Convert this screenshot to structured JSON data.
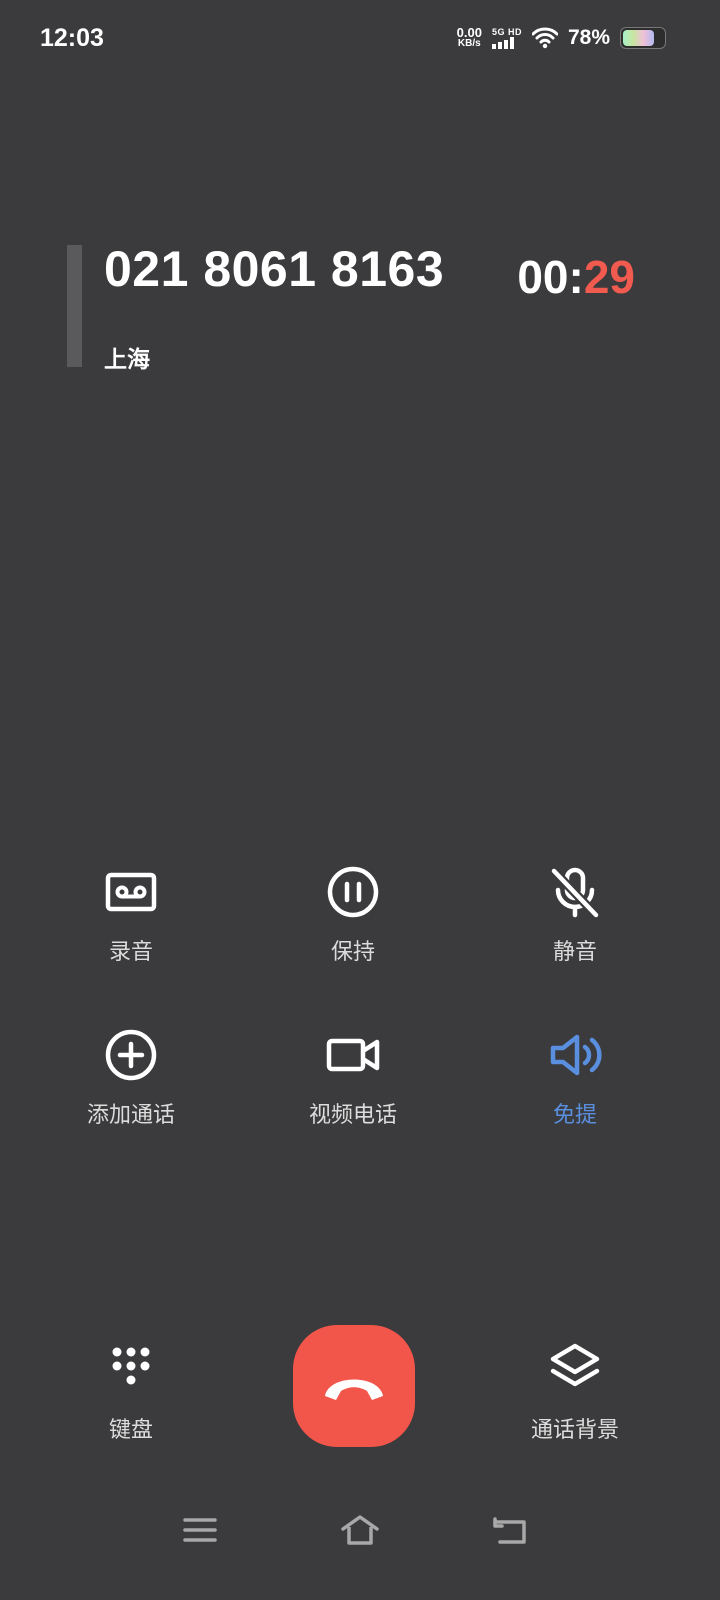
{
  "status_bar": {
    "time": "12:03",
    "net_speed_value": "0.00",
    "net_speed_unit": "KB/s",
    "network_label": "5G HD",
    "battery_percent": "78%",
    "battery_level": 0.78
  },
  "call": {
    "number": "021 8061 8163",
    "location": "上海",
    "timer_minutes": "00:",
    "timer_seconds": "29"
  },
  "controls": {
    "record": "录音",
    "hold": "保持",
    "mute": "静音",
    "add_call": "添加通话",
    "video_call": "视频电话",
    "speaker": "免提",
    "keypad": "键盘",
    "call_background": "通话背景"
  },
  "colors": {
    "background": "#3b3b3d",
    "end_call": "#f2554a",
    "active": "#5a8fe0",
    "timer_seconds": "#f15a4e"
  },
  "icons": {
    "record": "cassette-icon",
    "hold": "pause-circle-icon",
    "mute": "mic-off-icon",
    "add_call": "plus-circle-icon",
    "video_call": "video-camera-icon",
    "speaker": "speaker-icon",
    "keypad": "dialpad-icon",
    "call_background": "layers-icon",
    "end_call": "hang-up-icon"
  }
}
